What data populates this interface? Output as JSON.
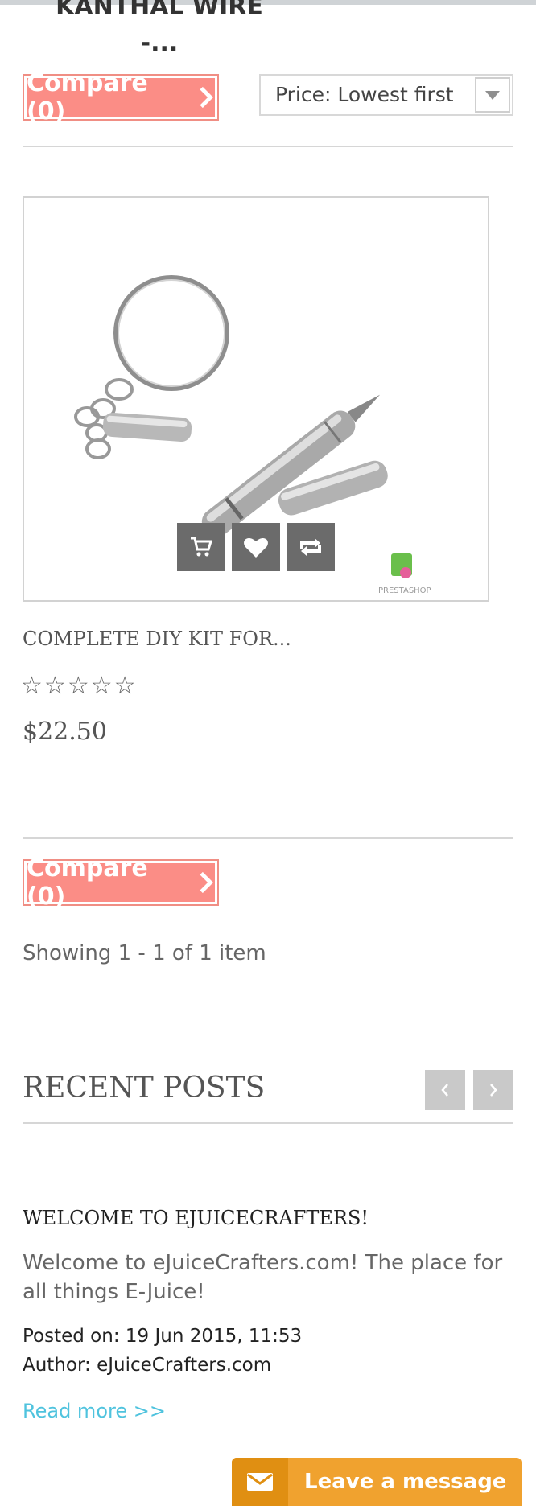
{
  "top_product": {
    "title_line1": "KANTHAL WIRE",
    "title_line2": "-..."
  },
  "toolbar": {
    "compare_label": "Compare (0)",
    "sort_value": "Price: Lowest first"
  },
  "product": {
    "name": "COMPLETE DIY KIT FOR...",
    "price": "$22.50",
    "rating": {
      "filled": 0,
      "max": 5
    },
    "image_watermark": "PRESTASHOP",
    "actions": [
      "cart-icon",
      "heart-icon",
      "compare-arrows-icon"
    ]
  },
  "bottom_toolbar": {
    "compare_label": "Compare (0)"
  },
  "pagination": {
    "showing_text": "Showing 1 - 1 of 1 item"
  },
  "recent_posts": {
    "heading": "RECENT POSTS",
    "post": {
      "title": "WELCOME TO EJUICECRAFTERS!",
      "excerpt": "Welcome to eJuiceCrafters.com! The place for all things E-Juice!",
      "posted_on": "Posted on: 19 Jun 2015, 11:53",
      "author": "Author: eJuiceCrafters.com",
      "read_more": "Read more >>"
    }
  },
  "chat_widget": {
    "label": "Leave a message"
  },
  "colors": {
    "compare_bg": "#fb8d86",
    "action_btn": "#6b6b6b",
    "link": "#4fc3de",
    "chat": "#f0a22f"
  }
}
